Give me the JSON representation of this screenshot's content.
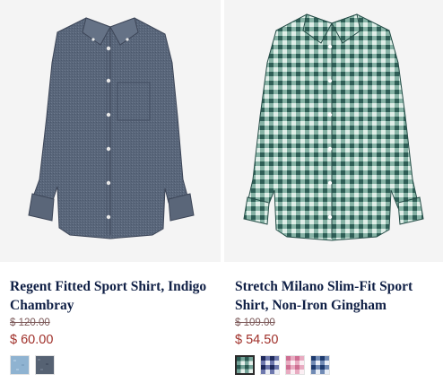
{
  "products": [
    {
      "name": "Regent Fitted Sport Shirt, Indigo Chambray",
      "original_price": "$ 120.00",
      "sale_price": "$ 60.00",
      "image_icon": "chambray-shirt-image",
      "swatches": [
        {
          "name": "light-chambray",
          "color": "#8fb3d1"
        },
        {
          "name": "indigo-chambray",
          "color": "#566273"
        }
      ],
      "selected_swatch": null
    },
    {
      "name": "Stretch Milano Slim-Fit Sport Shirt, Non-Iron Gingham",
      "original_price": "$ 109.00",
      "sale_price": "$ 54.50",
      "image_icon": "green-gingham-shirt-image",
      "swatches": [
        {
          "name": "green-gingham",
          "color": "#3f7a6c"
        },
        {
          "name": "navy-gingham",
          "color": "#27366b"
        },
        {
          "name": "pink-gingham",
          "color": "#d88aa6"
        },
        {
          "name": "blue-gingham",
          "color": "#2c4d82"
        }
      ],
      "selected_swatch": 0
    }
  ],
  "colors": {
    "title": "#0f1f45",
    "sale_price": "#a0302a",
    "original_price": "#7d5a5a",
    "image_background": "#f4f4f4"
  }
}
